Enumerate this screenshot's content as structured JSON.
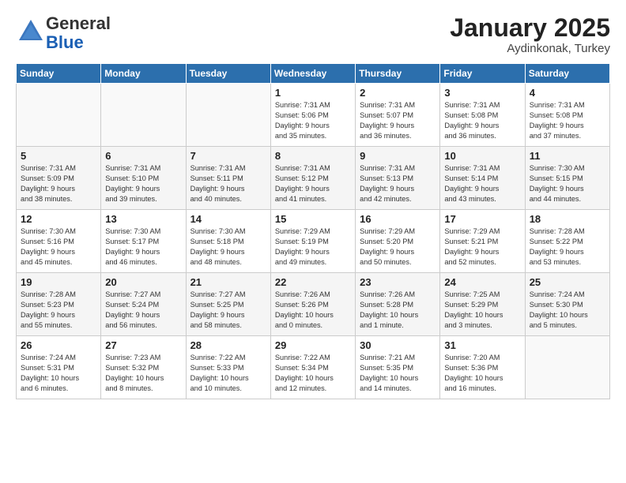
{
  "header": {
    "logo_general": "General",
    "logo_blue": "Blue",
    "month_year": "January 2025",
    "location": "Aydinkonak, Turkey"
  },
  "weekdays": [
    "Sunday",
    "Monday",
    "Tuesday",
    "Wednesday",
    "Thursday",
    "Friday",
    "Saturday"
  ],
  "weeks": [
    [
      {
        "day": "",
        "content": ""
      },
      {
        "day": "",
        "content": ""
      },
      {
        "day": "",
        "content": ""
      },
      {
        "day": "1",
        "content": "Sunrise: 7:31 AM\nSunset: 5:06 PM\nDaylight: 9 hours\nand 35 minutes."
      },
      {
        "day": "2",
        "content": "Sunrise: 7:31 AM\nSunset: 5:07 PM\nDaylight: 9 hours\nand 36 minutes."
      },
      {
        "day": "3",
        "content": "Sunrise: 7:31 AM\nSunset: 5:08 PM\nDaylight: 9 hours\nand 36 minutes."
      },
      {
        "day": "4",
        "content": "Sunrise: 7:31 AM\nSunset: 5:08 PM\nDaylight: 9 hours\nand 37 minutes."
      }
    ],
    [
      {
        "day": "5",
        "content": "Sunrise: 7:31 AM\nSunset: 5:09 PM\nDaylight: 9 hours\nand 38 minutes."
      },
      {
        "day": "6",
        "content": "Sunrise: 7:31 AM\nSunset: 5:10 PM\nDaylight: 9 hours\nand 39 minutes."
      },
      {
        "day": "7",
        "content": "Sunrise: 7:31 AM\nSunset: 5:11 PM\nDaylight: 9 hours\nand 40 minutes."
      },
      {
        "day": "8",
        "content": "Sunrise: 7:31 AM\nSunset: 5:12 PM\nDaylight: 9 hours\nand 41 minutes."
      },
      {
        "day": "9",
        "content": "Sunrise: 7:31 AM\nSunset: 5:13 PM\nDaylight: 9 hours\nand 42 minutes."
      },
      {
        "day": "10",
        "content": "Sunrise: 7:31 AM\nSunset: 5:14 PM\nDaylight: 9 hours\nand 43 minutes."
      },
      {
        "day": "11",
        "content": "Sunrise: 7:30 AM\nSunset: 5:15 PM\nDaylight: 9 hours\nand 44 minutes."
      }
    ],
    [
      {
        "day": "12",
        "content": "Sunrise: 7:30 AM\nSunset: 5:16 PM\nDaylight: 9 hours\nand 45 minutes."
      },
      {
        "day": "13",
        "content": "Sunrise: 7:30 AM\nSunset: 5:17 PM\nDaylight: 9 hours\nand 46 minutes."
      },
      {
        "day": "14",
        "content": "Sunrise: 7:30 AM\nSunset: 5:18 PM\nDaylight: 9 hours\nand 48 minutes."
      },
      {
        "day": "15",
        "content": "Sunrise: 7:29 AM\nSunset: 5:19 PM\nDaylight: 9 hours\nand 49 minutes."
      },
      {
        "day": "16",
        "content": "Sunrise: 7:29 AM\nSunset: 5:20 PM\nDaylight: 9 hours\nand 50 minutes."
      },
      {
        "day": "17",
        "content": "Sunrise: 7:29 AM\nSunset: 5:21 PM\nDaylight: 9 hours\nand 52 minutes."
      },
      {
        "day": "18",
        "content": "Sunrise: 7:28 AM\nSunset: 5:22 PM\nDaylight: 9 hours\nand 53 minutes."
      }
    ],
    [
      {
        "day": "19",
        "content": "Sunrise: 7:28 AM\nSunset: 5:23 PM\nDaylight: 9 hours\nand 55 minutes."
      },
      {
        "day": "20",
        "content": "Sunrise: 7:27 AM\nSunset: 5:24 PM\nDaylight: 9 hours\nand 56 minutes."
      },
      {
        "day": "21",
        "content": "Sunrise: 7:27 AM\nSunset: 5:25 PM\nDaylight: 9 hours\nand 58 minutes."
      },
      {
        "day": "22",
        "content": "Sunrise: 7:26 AM\nSunset: 5:26 PM\nDaylight: 10 hours\nand 0 minutes."
      },
      {
        "day": "23",
        "content": "Sunrise: 7:26 AM\nSunset: 5:28 PM\nDaylight: 10 hours\nand 1 minute."
      },
      {
        "day": "24",
        "content": "Sunrise: 7:25 AM\nSunset: 5:29 PM\nDaylight: 10 hours\nand 3 minutes."
      },
      {
        "day": "25",
        "content": "Sunrise: 7:24 AM\nSunset: 5:30 PM\nDaylight: 10 hours\nand 5 minutes."
      }
    ],
    [
      {
        "day": "26",
        "content": "Sunrise: 7:24 AM\nSunset: 5:31 PM\nDaylight: 10 hours\nand 6 minutes."
      },
      {
        "day": "27",
        "content": "Sunrise: 7:23 AM\nSunset: 5:32 PM\nDaylight: 10 hours\nand 8 minutes."
      },
      {
        "day": "28",
        "content": "Sunrise: 7:22 AM\nSunset: 5:33 PM\nDaylight: 10 hours\nand 10 minutes."
      },
      {
        "day": "29",
        "content": "Sunrise: 7:22 AM\nSunset: 5:34 PM\nDaylight: 10 hours\nand 12 minutes."
      },
      {
        "day": "30",
        "content": "Sunrise: 7:21 AM\nSunset: 5:35 PM\nDaylight: 10 hours\nand 14 minutes."
      },
      {
        "day": "31",
        "content": "Sunrise: 7:20 AM\nSunset: 5:36 PM\nDaylight: 10 hours\nand 16 minutes."
      },
      {
        "day": "",
        "content": ""
      }
    ]
  ]
}
